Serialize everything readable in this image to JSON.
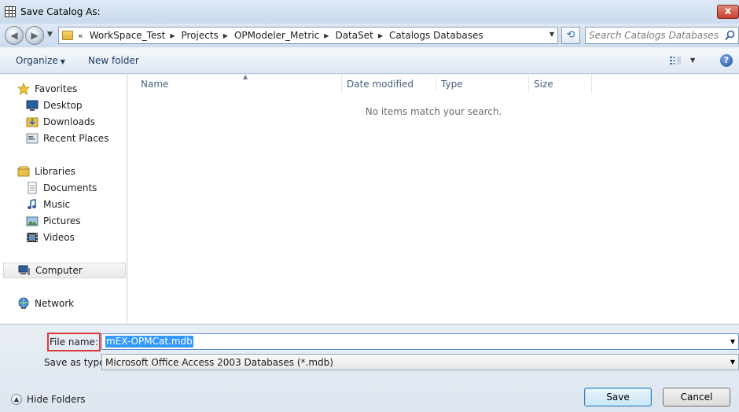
{
  "window": {
    "title": "Save Catalog As:",
    "close_label": "x"
  },
  "address": {
    "overflow_label": "«",
    "crumbs": [
      "WorkSpace_Test",
      "Projects",
      "OPModeler_Metric",
      "DataSet",
      "Catalogs Databases"
    ]
  },
  "search": {
    "placeholder": "Search Catalogs Databases"
  },
  "toolbar": {
    "organize_label": "Organize",
    "new_folder_label": "New folder",
    "help_label": "?"
  },
  "nav": {
    "favorites": {
      "label": "Favorites",
      "items": [
        "Desktop",
        "Downloads",
        "Recent Places"
      ]
    },
    "libraries": {
      "label": "Libraries",
      "items": [
        "Documents",
        "Music",
        "Pictures",
        "Videos"
      ]
    },
    "computer": {
      "label": "Computer"
    },
    "network": {
      "label": "Network"
    }
  },
  "file_list": {
    "columns": [
      "Name",
      "Date modified",
      "Type",
      "Size"
    ],
    "empty_message": "No items match your search."
  },
  "form": {
    "file_name_label": "File name:",
    "file_name_value": "mEX-OPMCat.mdb",
    "save_type_label": "Save as type:",
    "save_type_value": "Microsoft Office Access 2003 Databases (*.mdb)"
  },
  "footer": {
    "hide_folders_label": "Hide Folders",
    "save_label": "Save",
    "cancel_label": "Cancel"
  },
  "colors": {
    "accent": "#3399ff",
    "highlight_border": "#d9383a"
  }
}
